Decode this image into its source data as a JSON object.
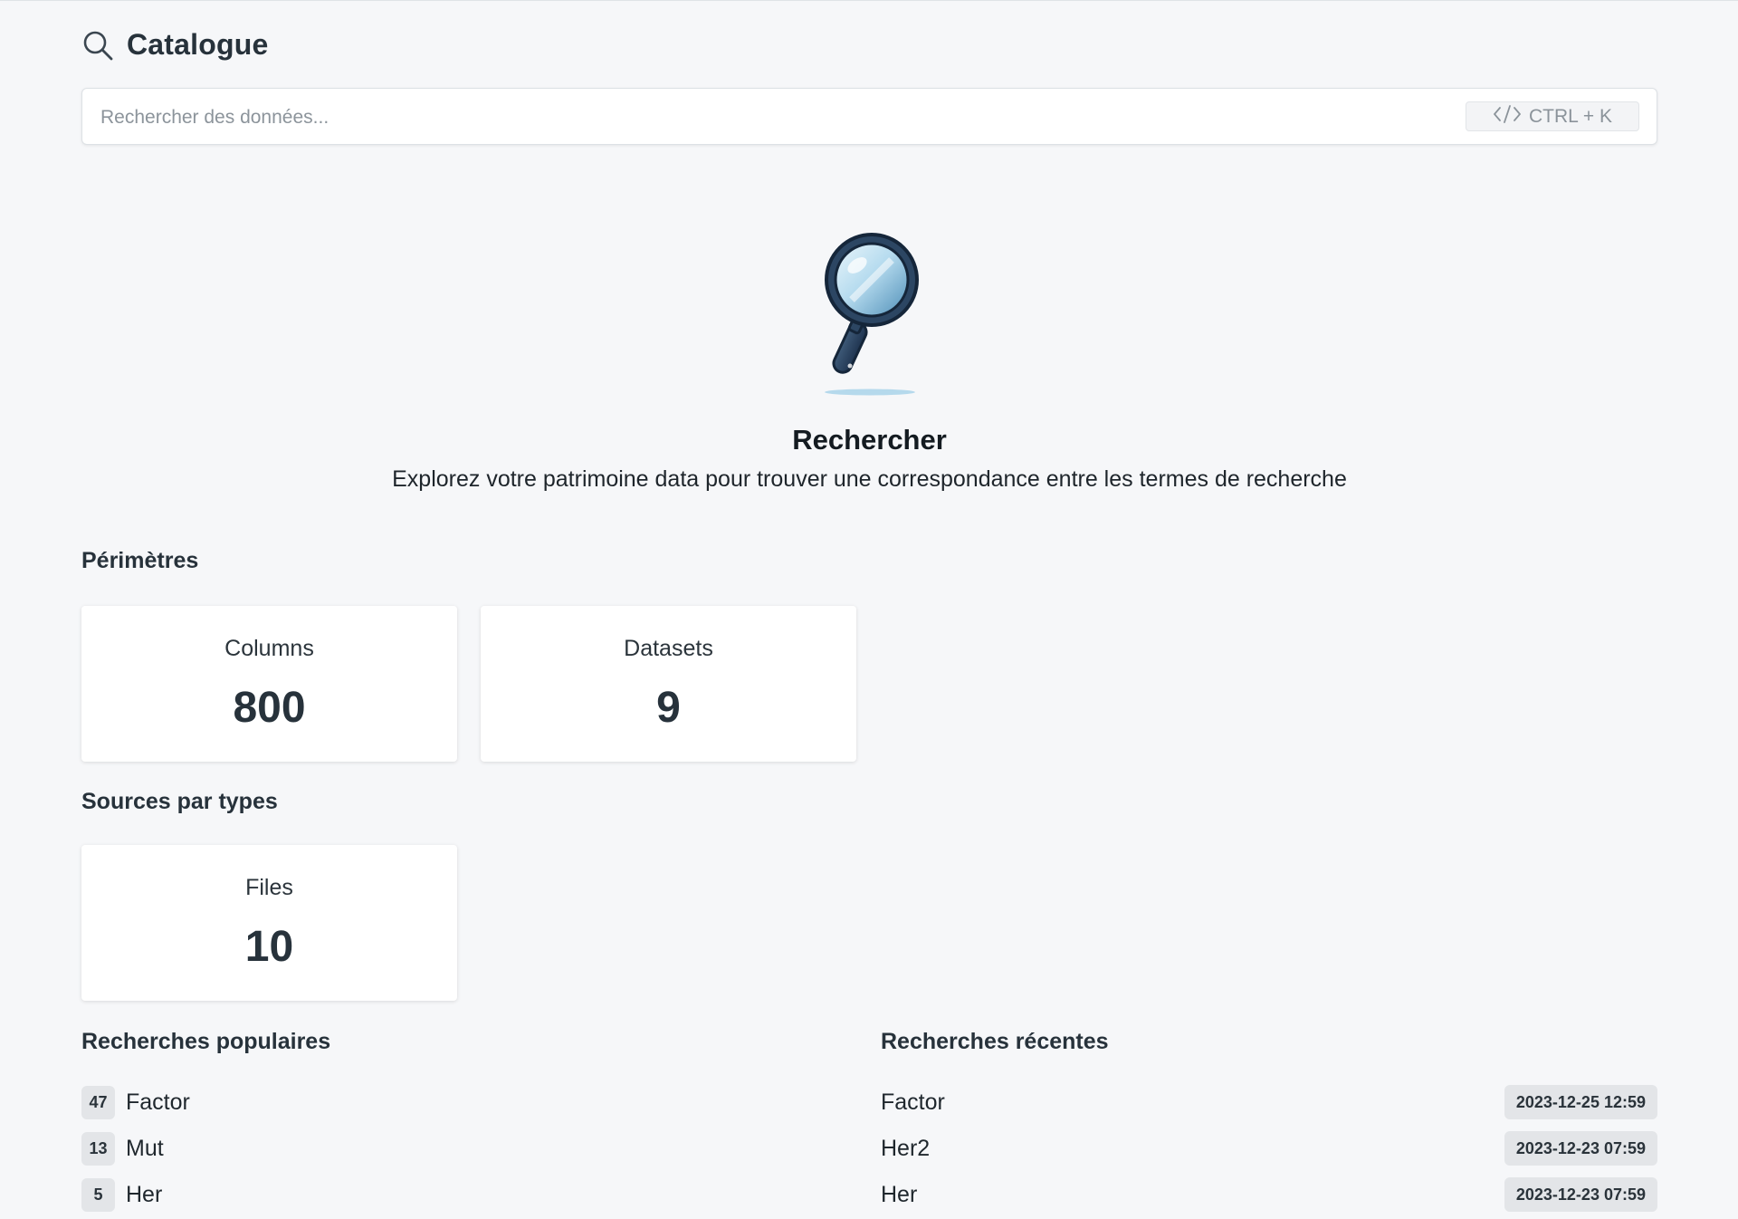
{
  "header": {
    "title": "Catalogue",
    "icon": "search-icon"
  },
  "search": {
    "placeholder": "Rechercher des données...",
    "shortcut": "CTRL + K",
    "shortcut_icon": "code-icon"
  },
  "hero": {
    "illustration": "magnifying-glass-illustration",
    "title": "Rechercher",
    "subtitle": "Explorez votre patrimoine data pour trouver une correspondance entre les termes de recherche"
  },
  "perimeters": {
    "title": "Périmètres",
    "cards": [
      {
        "label": "Columns",
        "value": "800"
      },
      {
        "label": "Datasets",
        "value": "9"
      }
    ]
  },
  "sources": {
    "title": "Sources par types",
    "cards": [
      {
        "label": "Files",
        "value": "10"
      }
    ]
  },
  "popular": {
    "title": "Recherches populaires",
    "items": [
      {
        "count": "47",
        "term": "Factor"
      },
      {
        "count": "13",
        "term": "Mut"
      },
      {
        "count": "5",
        "term": "Her"
      }
    ]
  },
  "recent": {
    "title": "Recherches récentes",
    "items": [
      {
        "term": "Factor",
        "date": "2023-12-25 12:59"
      },
      {
        "term": "Her2",
        "date": "2023-12-23 07:59"
      },
      {
        "term": "Her",
        "date": "2023-12-23 07:59"
      }
    ]
  }
}
